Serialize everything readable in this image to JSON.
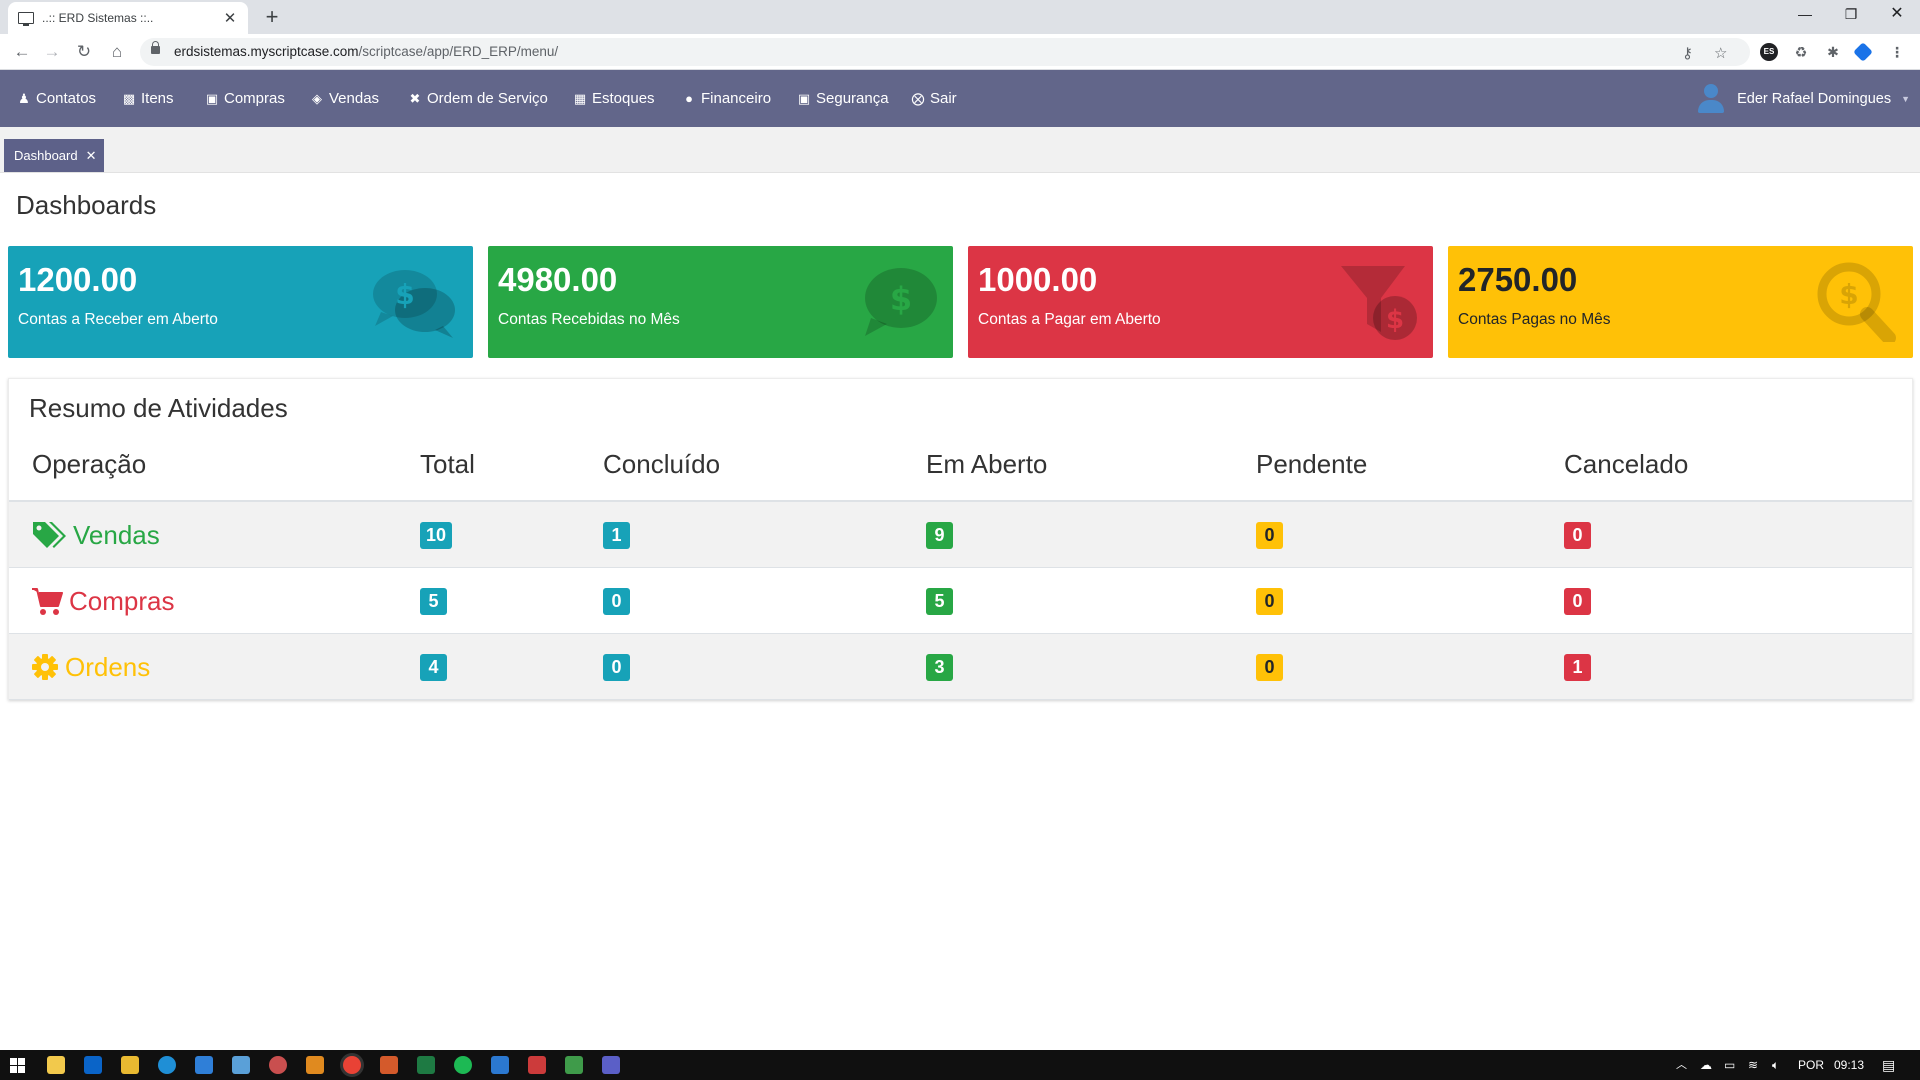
{
  "browser": {
    "tab_title": "..:: ERD Sistemas ::..",
    "url_host": "erdsistemas.myscriptcase.com",
    "url_path": "/scriptcase/app/ERD_ERP/menu/"
  },
  "menu": {
    "items": [
      {
        "label": "Contatos",
        "icon": "user-icon"
      },
      {
        "label": "Itens",
        "icon": "boxes-icon"
      },
      {
        "label": "Compras",
        "icon": "shopping-bag-icon"
      },
      {
        "label": "Vendas",
        "icon": "tags-icon"
      },
      {
        "label": "Ordem de Serviço",
        "icon": "tools-icon"
      },
      {
        "label": "Estoques",
        "icon": "warehouse-icon"
      },
      {
        "label": "Financeiro",
        "icon": "money-icon"
      },
      {
        "label": "Segurança",
        "icon": "lock-icon"
      },
      {
        "label": "Sair",
        "icon": "exit-icon"
      }
    ],
    "user_name": "Eder Rafael Domingues"
  },
  "app_tabs": [
    {
      "label": "Dashboard"
    }
  ],
  "page_title": "Dashboards",
  "cards": [
    {
      "value": "1200.00",
      "label": "Contas a Receber em Aberto",
      "color": "#17a2b8",
      "icon": "comments-dollar-icon"
    },
    {
      "value": "4980.00",
      "label": "Contas Recebidas no Mês",
      "color": "#28a745",
      "icon": "comment-dollar-icon"
    },
    {
      "value": "1000.00",
      "label": "Contas a Pagar em Aberto",
      "color": "#dc3545",
      "icon": "funnel-dollar-icon"
    },
    {
      "value": "2750.00",
      "label": "Contas Pagas no Mês",
      "color": "#ffc107",
      "icon": "search-dollar-icon"
    }
  ],
  "summary": {
    "title": "Resumo de Atividades",
    "columns": [
      "Operação",
      "Total",
      "Concluído",
      "Em Aberto",
      "Pendente",
      "Cancelado"
    ],
    "rows": [
      {
        "name": "Vendas",
        "icon": "tags-icon",
        "color": "#28a745",
        "values": [
          "10",
          "1",
          "9",
          "0",
          "0"
        ]
      },
      {
        "name": "Compras",
        "icon": "cart-icon",
        "color": "#dc3545",
        "values": [
          "5",
          "0",
          "5",
          "0",
          "0"
        ]
      },
      {
        "name": "Ordens",
        "icon": "cog-icon",
        "color": "#ffc107",
        "values": [
          "4",
          "0",
          "3",
          "0",
          "1"
        ]
      }
    ],
    "badge_colors": [
      "#17a2b8",
      "#17a2b8",
      "#28a745",
      "#ffc107",
      "#dc3545"
    ]
  },
  "taskbar": {
    "language": "POR",
    "time": "09:13"
  }
}
